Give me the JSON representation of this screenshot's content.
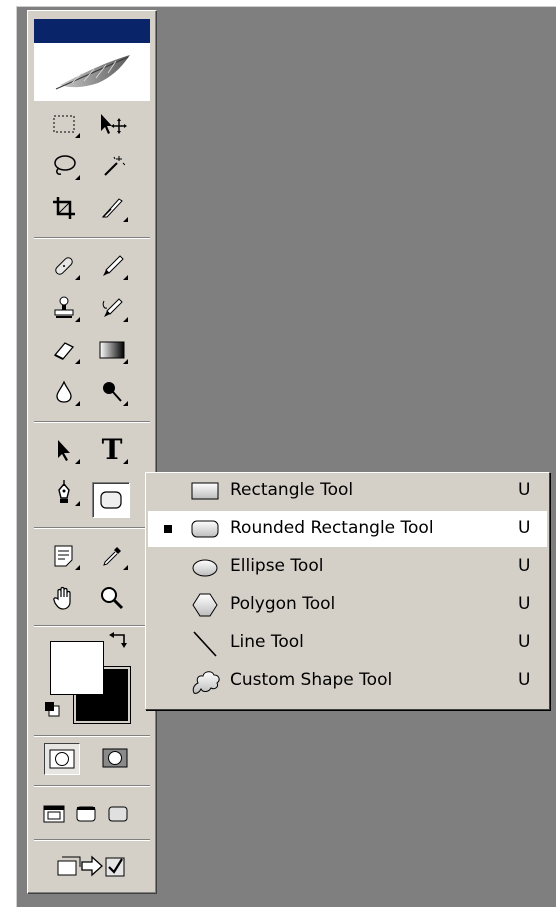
{
  "toolbox": {
    "title": "",
    "tools": [
      {
        "name": "marquee-tool",
        "icon": "marquee-icon"
      },
      {
        "name": "move-tool",
        "icon": "move-icon"
      },
      {
        "name": "lasso-tool",
        "icon": "lasso-icon"
      },
      {
        "name": "magic-wand-tool",
        "icon": "magic-wand-icon"
      },
      {
        "name": "crop-tool",
        "icon": "crop-icon"
      },
      {
        "name": "slice-tool",
        "icon": "slice-icon"
      },
      {
        "name": "healing-brush-tool",
        "icon": "bandage-icon"
      },
      {
        "name": "brush-tool",
        "icon": "brush-icon"
      },
      {
        "name": "clone-stamp-tool",
        "icon": "stamp-icon"
      },
      {
        "name": "history-brush-tool",
        "icon": "history-brush-icon"
      },
      {
        "name": "eraser-tool",
        "icon": "eraser-icon"
      },
      {
        "name": "gradient-tool",
        "icon": "gradient-icon"
      },
      {
        "name": "blur-tool",
        "icon": "drop-icon"
      },
      {
        "name": "dodge-tool",
        "icon": "dodge-icon"
      },
      {
        "name": "path-selection-tool",
        "icon": "arrow-icon"
      },
      {
        "name": "type-tool",
        "icon": "type-icon",
        "glyph": "T"
      },
      {
        "name": "pen-tool",
        "icon": "pen-icon"
      },
      {
        "name": "shape-tool",
        "icon": "rounded-rectangle-icon"
      },
      {
        "name": "notes-tool",
        "icon": "note-icon"
      },
      {
        "name": "eyedropper-tool",
        "icon": "eyedropper-icon"
      },
      {
        "name": "hand-tool",
        "icon": "hand-icon"
      },
      {
        "name": "zoom-tool",
        "icon": "magnifier-icon"
      }
    ],
    "colors": {
      "foreground": "#ffffff",
      "background": "#000000"
    }
  },
  "flyout": {
    "selected_index": 1,
    "items": [
      {
        "label": "Rectangle Tool",
        "shortcut": "U",
        "icon": "rectangle-icon"
      },
      {
        "label": "Rounded Rectangle Tool",
        "shortcut": "U",
        "icon": "rounded-rectangle-icon"
      },
      {
        "label": "Ellipse Tool",
        "shortcut": "U",
        "icon": "ellipse-icon"
      },
      {
        "label": "Polygon Tool",
        "shortcut": "U",
        "icon": "polygon-icon"
      },
      {
        "label": "Line Tool",
        "shortcut": "U",
        "icon": "line-icon"
      },
      {
        "label": "Custom Shape Tool",
        "shortcut": "U",
        "icon": "custom-shape-icon"
      }
    ]
  },
  "colors": {
    "canvas": "#7f7f7f",
    "panel": "#d4d0c8",
    "title_bar": "#0a246a",
    "highlight": "#ffffff"
  }
}
